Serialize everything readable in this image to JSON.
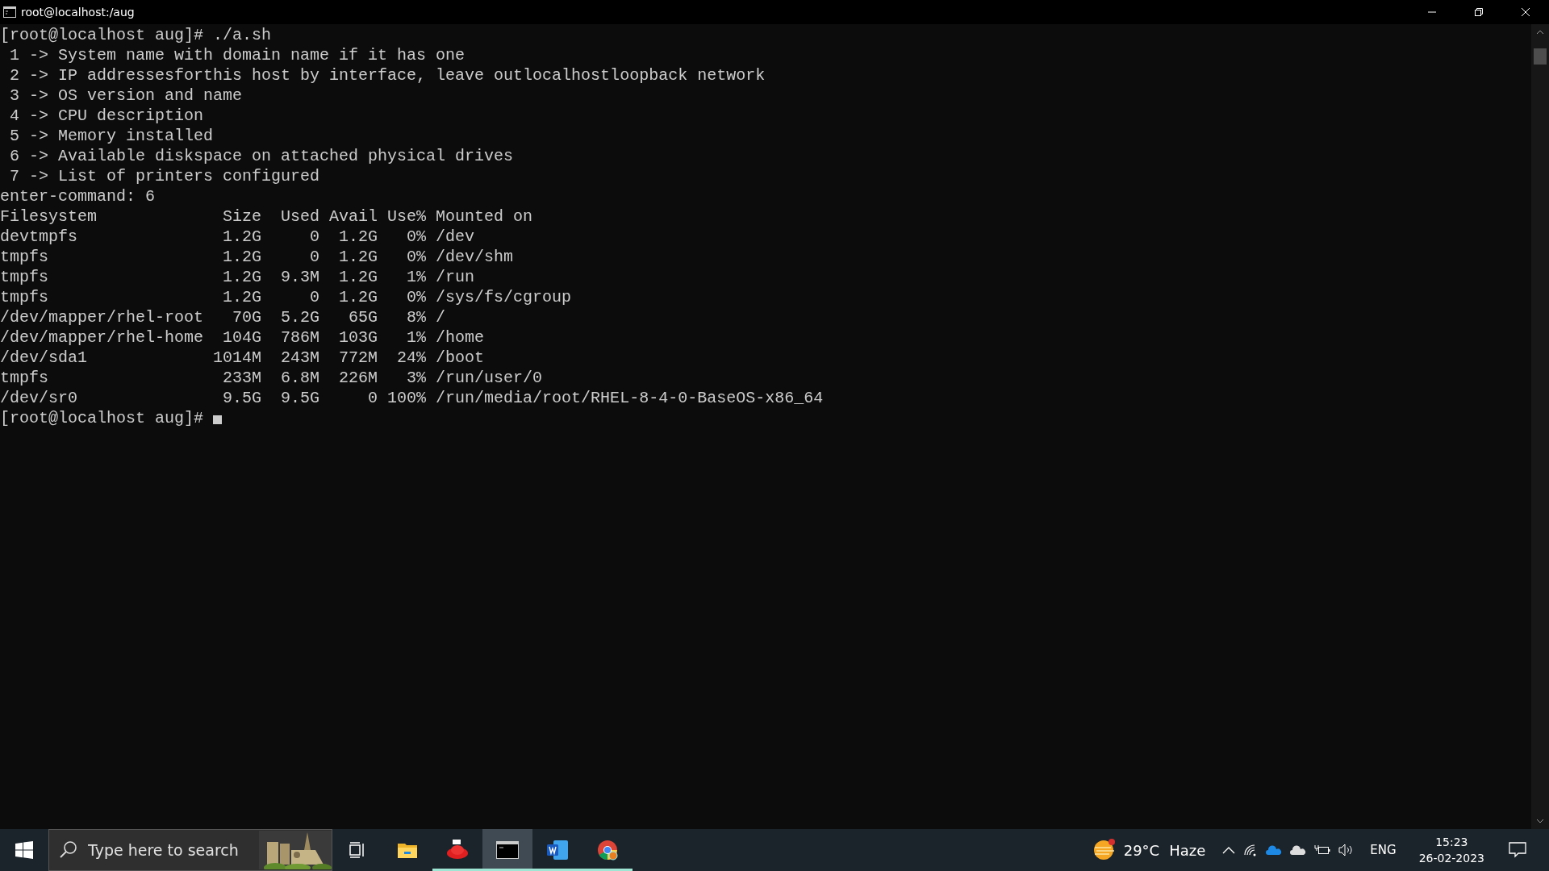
{
  "window": {
    "title": "root@localhost:/aug"
  },
  "terminal": {
    "lines": [
      "[root@localhost aug]# ./a.sh",
      " 1 -> System name with domain name if it has one",
      " 2 -> IP addressesforthis host by interface, leave outlocalhostloopback network",
      " 3 -> OS version and name",
      " 4 -> CPU description",
      " 5 -> Memory installed",
      " 6 -> Available diskspace on attached physical drives",
      " 7 -> List of printers configured",
      "enter-command: 6",
      "Filesystem             Size  Used Avail Use% Mounted on",
      "devtmpfs               1.2G     0  1.2G   0% /dev",
      "tmpfs                  1.2G     0  1.2G   0% /dev/shm",
      "tmpfs                  1.2G  9.3M  1.2G   1% /run",
      "tmpfs                  1.2G     0  1.2G   0% /sys/fs/cgroup",
      "/dev/mapper/rhel-root   70G  5.2G   65G   8% /",
      "/dev/mapper/rhel-home  104G  786M  103G   1% /home",
      "/dev/sda1             1014M  243M  772M  24% /boot",
      "tmpfs                  233M  6.8M  226M   3% /run/user/0",
      "/dev/sr0               9.5G  9.5G     0 100% /run/media/root/RHEL-8-4-0-BaseOS-x86_64"
    ],
    "prompt": "[root@localhost aug]# "
  },
  "taskbar": {
    "search": {
      "placeholder": "Type here to search"
    },
    "apps": [
      {
        "kind": "taskview",
        "running": false,
        "selected": false
      },
      {
        "kind": "explorer",
        "running": false,
        "selected": false
      },
      {
        "kind": "redhat",
        "running": true,
        "selected": false
      },
      {
        "kind": "terminal",
        "running": true,
        "selected": true
      },
      {
        "kind": "word",
        "running": true,
        "selected": false
      },
      {
        "kind": "chrome",
        "running": true,
        "selected": false
      }
    ],
    "weather": {
      "temperature": "29°C",
      "condition": "Haze"
    },
    "language": "ENG",
    "time": "15:23",
    "date": "26-02-2023"
  }
}
